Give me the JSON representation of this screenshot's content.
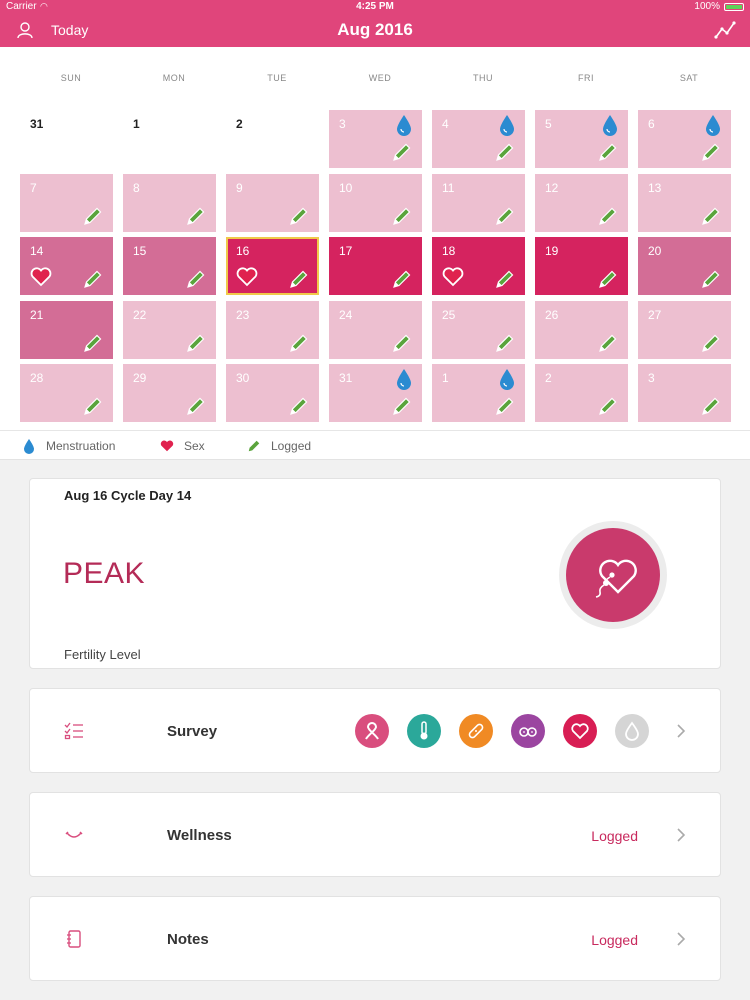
{
  "status_bar": {
    "carrier": "Carrier",
    "time": "4:25 PM",
    "battery": "100%"
  },
  "nav": {
    "today_label": "Today",
    "title": "Aug 2016"
  },
  "calendar": {
    "weekdays": [
      "SUN",
      "MON",
      "TUE",
      "WED",
      "THU",
      "FRI",
      "SAT"
    ],
    "weeks": [
      [
        {
          "day": "31",
          "state": "blank"
        },
        {
          "day": "1",
          "state": "blank"
        },
        {
          "day": "2",
          "state": "blank"
        },
        {
          "day": "3",
          "state": "light",
          "drop": true,
          "pencil": true
        },
        {
          "day": "4",
          "state": "light",
          "drop": true,
          "pencil": true
        },
        {
          "day": "5",
          "state": "light",
          "drop": true,
          "pencil": true
        },
        {
          "day": "6",
          "state": "light",
          "drop": true,
          "pencil": true
        }
      ],
      [
        {
          "day": "7",
          "state": "light",
          "pencil": true
        },
        {
          "day": "8",
          "state": "light",
          "pencil": true
        },
        {
          "day": "9",
          "state": "light",
          "pencil": true
        },
        {
          "day": "10",
          "state": "light",
          "pencil": true
        },
        {
          "day": "11",
          "state": "light",
          "pencil": true
        },
        {
          "day": "12",
          "state": "light",
          "pencil": true
        },
        {
          "day": "13",
          "state": "light",
          "pencil": true
        }
      ],
      [
        {
          "day": "14",
          "state": "medium",
          "heart": true,
          "pencil": true
        },
        {
          "day": "15",
          "state": "medium",
          "pencil": true
        },
        {
          "day": "16",
          "state": "dark",
          "heart": true,
          "pencil": true,
          "selected": true
        },
        {
          "day": "17",
          "state": "dark",
          "pencil": true
        },
        {
          "day": "18",
          "state": "dark",
          "heart": true,
          "pencil": true
        },
        {
          "day": "19",
          "state": "dark",
          "pencil": true
        },
        {
          "day": "20",
          "state": "medium",
          "pencil": true
        }
      ],
      [
        {
          "day": "21",
          "state": "medium",
          "pencil": true
        },
        {
          "day": "22",
          "state": "light",
          "pencil": true
        },
        {
          "day": "23",
          "state": "light",
          "pencil": true
        },
        {
          "day": "24",
          "state": "light",
          "pencil": true
        },
        {
          "day": "25",
          "state": "light",
          "pencil": true
        },
        {
          "day": "26",
          "state": "light",
          "pencil": true
        },
        {
          "day": "27",
          "state": "light",
          "pencil": true
        }
      ],
      [
        {
          "day": "28",
          "state": "light",
          "pencil": true
        },
        {
          "day": "29",
          "state": "light",
          "pencil": true
        },
        {
          "day": "30",
          "state": "light",
          "pencil": true
        },
        {
          "day": "31",
          "state": "light",
          "drop": true,
          "pencil": true
        },
        {
          "day": "1",
          "state": "light",
          "drop": true,
          "pencil": true
        },
        {
          "day": "2",
          "state": "light",
          "pencil": true
        },
        {
          "day": "3",
          "state": "light",
          "pencil": true
        }
      ]
    ]
  },
  "legend": {
    "menstruation": "Menstruation",
    "sex": "Sex",
    "logged": "Logged"
  },
  "fertility": {
    "date": "Aug 16",
    "cycle_day": "Cycle Day 14",
    "level": "PEAK",
    "caption": "Fertility Level"
  },
  "survey": {
    "label": "Survey",
    "icons": [
      "ribbon-icon",
      "thermometer-icon",
      "bandage-icon",
      "breasts-icon",
      "heart-icon",
      "drop-icon"
    ]
  },
  "wellness": {
    "label": "Wellness",
    "status": "Logged"
  },
  "notes": {
    "label": "Notes",
    "status": "Logged"
  },
  "colors": {
    "brand": "#e0457b",
    "light_cell": "#edbfd0",
    "medium_cell": "#d36d96",
    "dark_cell": "#d5235f",
    "selected_border": "#f0c94a",
    "drop": "#2b8bd1",
    "pencil": "#5aa43c",
    "heart": "#e0224e",
    "survey_colors": [
      "#d94e7e",
      "#2ba89a",
      "#f08a24",
      "#9b45a0",
      "#d81e54",
      "#d5d5d5"
    ]
  }
}
